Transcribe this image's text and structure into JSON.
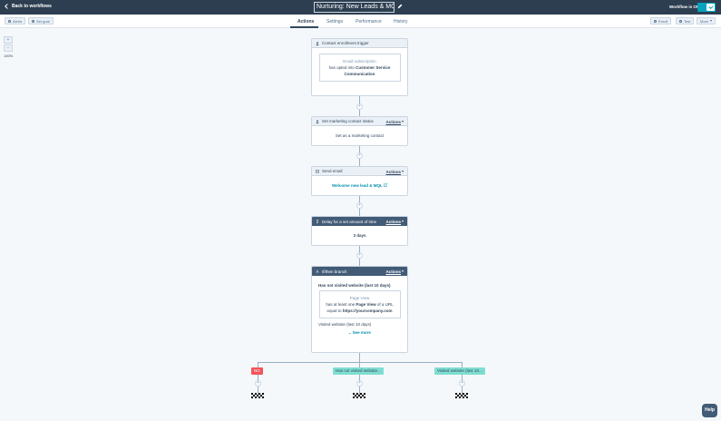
{
  "header": {
    "back_label": "Back to workflows",
    "title": "Nurturing: New Leads & MQLs",
    "status_label": "Workflow is ON"
  },
  "toolbar": {
    "alerts_label": "Alerts",
    "set_goal_label": "Set goal",
    "enroll_label": "Enroll",
    "test_label": "Test",
    "more_label": "More"
  },
  "tabs": [
    {
      "label": "Actions",
      "active": true
    },
    {
      "label": "Settings",
      "active": false
    },
    {
      "label": "Performance",
      "active": false
    },
    {
      "label": "History",
      "active": false
    }
  ],
  "zoom": {
    "plus": "+",
    "minus": "−",
    "level": "100%"
  },
  "workflow": {
    "actions_label": "Actions",
    "trigger": {
      "title": "Contact enrollment trigger",
      "filter_type": "Email subscription",
      "filter_prefix": "has opted into",
      "filter_value": "Customer Service Communication"
    },
    "step1": {
      "title": "Set marketing contact status",
      "body": "Set as a marketing contact"
    },
    "step2": {
      "title": "Send email",
      "email_name": "Welcome new lead & MQL"
    },
    "step3": {
      "title": "Delay for a set amount of time",
      "delay": "3 days"
    },
    "step4": {
      "title": "If/then branch",
      "branch1_title": "Has not visited website (last 10 days)",
      "filter_type": "Page View",
      "filter_line1_pre": "has at least one",
      "filter_line1_bold": "Page View",
      "filter_line1_post": "of a URL",
      "filter_line2_pre": "equal to",
      "filter_line2_bold": "https://yourcompany.com",
      "branch2_title": "Visited website (last 10 days)",
      "see_more": "See more"
    },
    "branches": [
      {
        "label": "NO",
        "color": "#f2545b"
      },
      {
        "label": "Has not visited website...",
        "color": "#7fded2"
      },
      {
        "label": "Visited website (last 10...",
        "color": "#7fded2"
      }
    ]
  },
  "help_label": "Help"
}
